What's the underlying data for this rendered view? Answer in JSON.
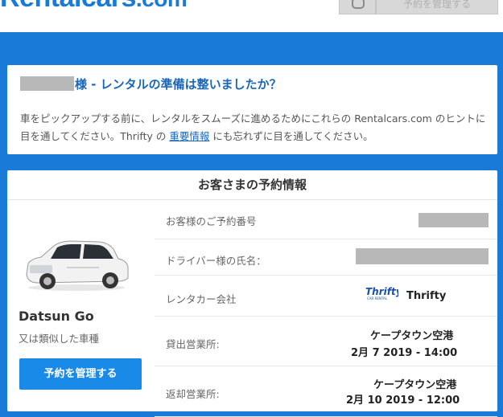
{
  "header": {
    "logo_main": "Rentalcars",
    "logo_tld": ".com",
    "manage_label": "予約を管理する"
  },
  "ready_card": {
    "heading": "様 - レンタルの準備は整いましたか？",
    "intro_before": "車をピックアップする前に、レンタルをスムーズに進めるためにこれらの Rentalcars.com のヒントに目を通してください。Thrifty の ",
    "intro_link": "重要情報",
    "intro_after": " にも忘れずに目を通してください。"
  },
  "booking": {
    "title": "お客さまの予約情報",
    "car_name": "Datsun Go",
    "car_sub": "又は類似した車種",
    "manage_button": "予約を管理する",
    "rows": [
      {
        "label": "お客様のご予約番号"
      },
      {
        "label": "ドライバー様の氏名："
      },
      {
        "label": "レンタカー会社",
        "value": "Thrifty",
        "logo_text": "Thrifty",
        "logo_sub": "CAR RENTAL"
      },
      {
        "label": "貸出営業所:",
        "place": "ケープタウン空港",
        "datetime": "2月 7 2019 - 14:00"
      },
      {
        "label": "返却営業所:",
        "place": "ケープタウン空港",
        "datetime": "2月 10 2019 - 12:00"
      }
    ]
  },
  "colors": {
    "brand": "#1a7ad8",
    "button": "#1a8ae8",
    "heading": "#1a66b8",
    "redaction": "#b8b8b8"
  }
}
